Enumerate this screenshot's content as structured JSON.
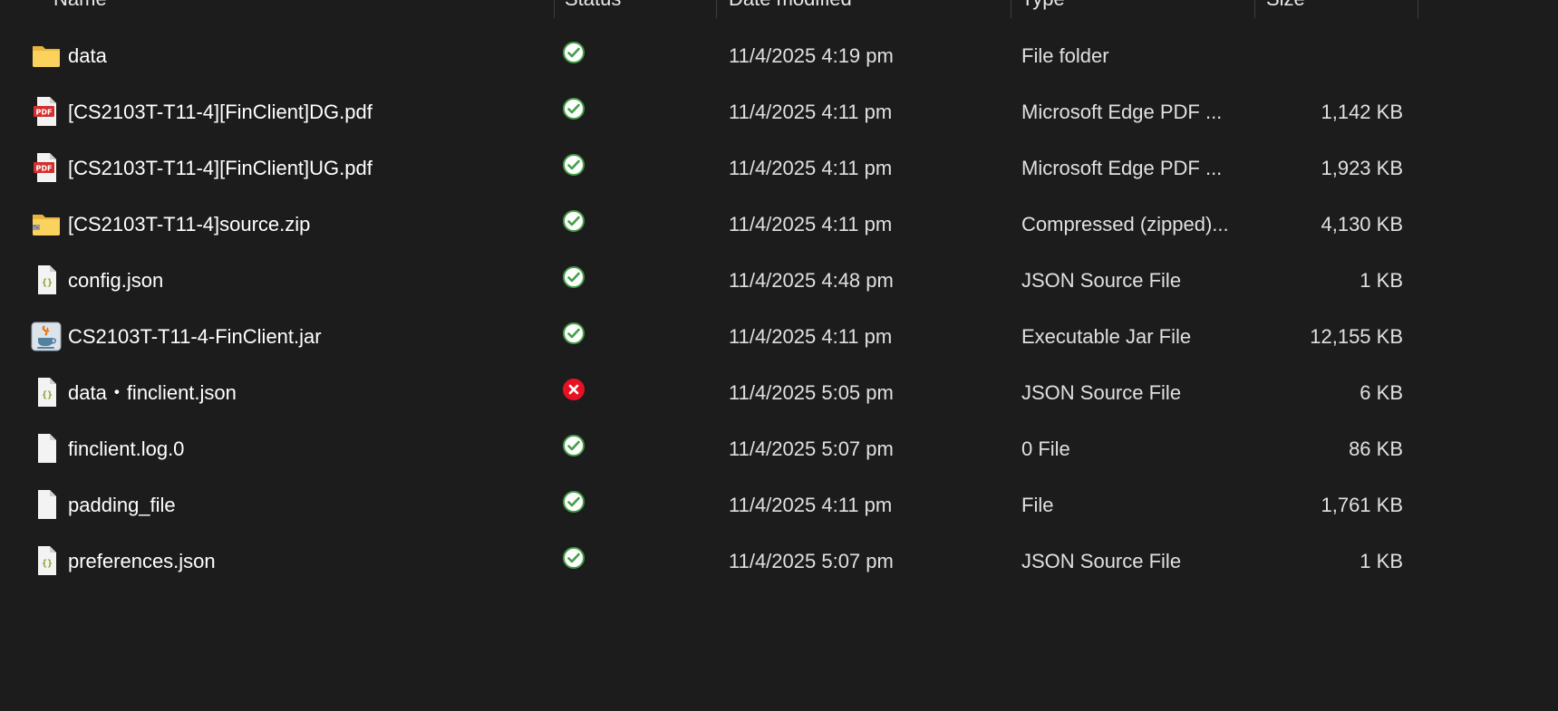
{
  "columns": {
    "name": "Name",
    "status": "Status",
    "date": "Date modified",
    "type": "Type",
    "size": "Size"
  },
  "files": [
    {
      "name": "data",
      "status": "synced",
      "date": "11/4/2025 4:19 pm",
      "type": "File folder",
      "size": "",
      "icon": "folder-icon"
    },
    {
      "name": "[CS2103T-T11-4][FinClient]DG.pdf",
      "status": "synced",
      "date": "11/4/2025 4:11 pm",
      "type": "Microsoft Edge PDF ...",
      "size": "1,142 KB",
      "icon": "pdf-icon"
    },
    {
      "name": "[CS2103T-T11-4][FinClient]UG.pdf",
      "status": "synced",
      "date": "11/4/2025 4:11 pm",
      "type": "Microsoft Edge PDF ...",
      "size": "1,923 KB",
      "icon": "pdf-icon"
    },
    {
      "name": "[CS2103T-T11-4]source.zip",
      "status": "synced",
      "date": "11/4/2025 4:11 pm",
      "type": "Compressed (zipped)...",
      "size": "4,130 KB",
      "icon": "zip-folder-icon"
    },
    {
      "name": "config.json",
      "status": "synced",
      "date": "11/4/2025 4:48 pm",
      "type": "JSON Source File",
      "size": "1 KB",
      "icon": "json-file-icon"
    },
    {
      "name": "CS2103T-T11-4-FinClient.jar",
      "status": "synced",
      "date": "11/4/2025 4:11 pm",
      "type": "Executable Jar File",
      "size": "12,155 KB",
      "icon": "java-jar-icon"
    },
    {
      "name": "data・finclient.json",
      "status": "error",
      "date": "11/4/2025 5:05 pm",
      "type": "JSON Source File",
      "size": "6 KB",
      "icon": "json-file-icon"
    },
    {
      "name": "finclient.log.0",
      "status": "synced",
      "date": "11/4/2025 5:07 pm",
      "type": "0 File",
      "size": "86 KB",
      "icon": "blank-file-icon"
    },
    {
      "name": "padding_file",
      "status": "synced",
      "date": "11/4/2025 4:11 pm",
      "type": "File",
      "size": "1,761 KB",
      "icon": "blank-file-icon"
    },
    {
      "name": "preferences.json",
      "status": "synced",
      "date": "11/4/2025 5:07 pm",
      "type": "JSON Source File",
      "size": "1 KB",
      "icon": "json-file-icon"
    }
  ],
  "colors": {
    "background": "#1c1c1c",
    "sync_ok": "#5cb85c",
    "sync_error": "#e81123",
    "folder": "#f8c948",
    "pdf": "#d32f2f"
  }
}
